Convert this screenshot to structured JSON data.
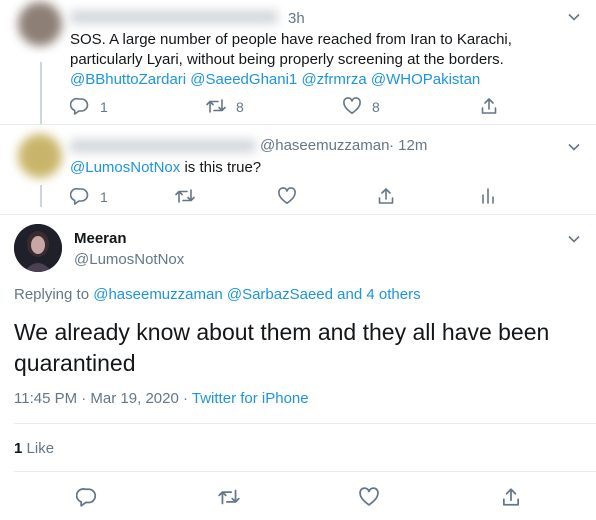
{
  "tweet1": {
    "name": "",
    "time": "3h",
    "text_line1": "SOS. A large number of people have reached from Iran to Karachi,",
    "text_line2": "particularly Lyari, without being properly screening at the borders.",
    "mentions": [
      "@BBhuttoZardari",
      "@SaeedGhani1",
      "@zfrmrza",
      "@WHOPakistan"
    ],
    "reply_count": "1",
    "retweet_count": "8",
    "like_count": "8"
  },
  "tweet2": {
    "handle": "@haseemuzzaman",
    "time": "· 12m",
    "mention": "@LumosNotNox",
    "text": "is this true?",
    "reply_count": "1"
  },
  "main": {
    "name": "Meeran",
    "handle": "@LumosNotNox",
    "replying_prefix": "Replying to",
    "replying_users": [
      "@haseemuzzaman",
      "@SarbazSaeed"
    ],
    "replying_others": "and 4 others",
    "text_line1": "We already know about them and they all have been",
    "text_line2": "quarantined",
    "timestamp": "11:45 PM · Mar 19, 2020 ·",
    "source": "Twitter for iPhone",
    "likes_count": "1",
    "likes_label": "Like"
  },
  "icons": {
    "reply": "reply-icon",
    "retweet": "retweet-icon",
    "like": "heart-icon",
    "share": "share-icon",
    "analytics": "analytics-icon",
    "more": "chevron-down-icon"
  },
  "colors": {
    "link": "#1b95e0",
    "muted": "#657786",
    "text": "#14171a",
    "divider": "#e6ecf0"
  }
}
